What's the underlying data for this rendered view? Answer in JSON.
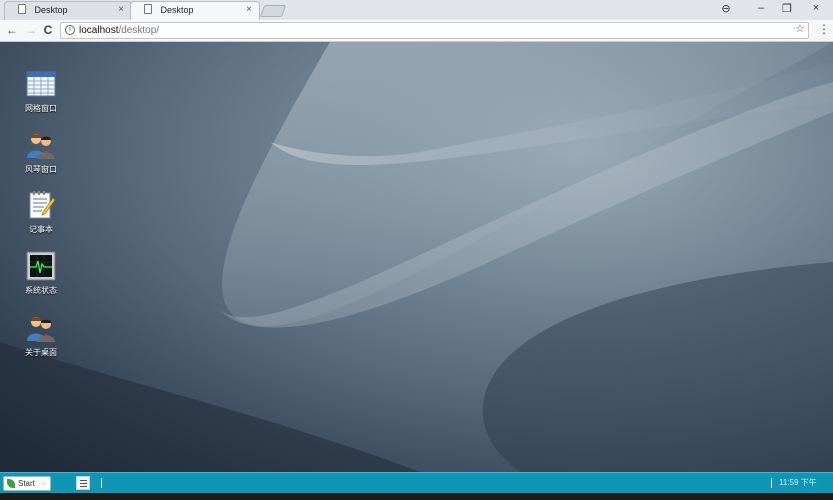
{
  "browser": {
    "tabs": [
      {
        "label": "Desktop",
        "active": false
      },
      {
        "label": "Desktop",
        "active": true
      }
    ],
    "close_glyph": "×",
    "window_controls": {
      "account": "⊖",
      "minimize": "–",
      "restore": "❐",
      "close": "×"
    },
    "nav": {
      "back": "←",
      "forward": "→",
      "reload": "C"
    },
    "address": {
      "host": "localhost",
      "path": "/desktop/"
    },
    "star": "☆",
    "menu": "⋮"
  },
  "desktop": {
    "icons": [
      {
        "label": "网格窗口",
        "icon": "grid-window-icon"
      },
      {
        "label": "风琴窗口",
        "icon": "accordion-window-icon"
      },
      {
        "label": "记事本",
        "icon": "notepad-icon"
      },
      {
        "label": "系统状态",
        "icon": "system-status-icon"
      },
      {
        "label": "关于桌面",
        "icon": "about-desktop-icon"
      }
    ]
  },
  "taskbar": {
    "start_label": "Start",
    "start_caret": "⌵",
    "clock": "11:59 下午",
    "color": "#0f95b5"
  }
}
